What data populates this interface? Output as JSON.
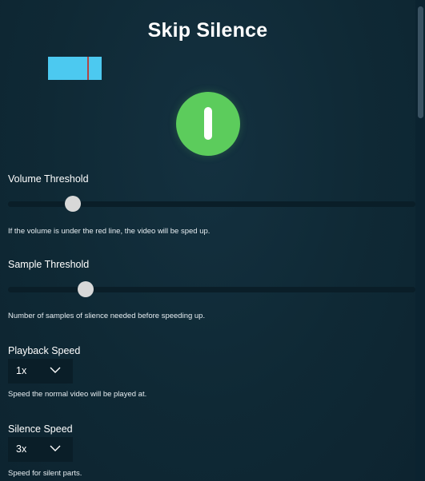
{
  "app": {
    "title": "Skip Silence"
  },
  "volume_meter": {
    "level": 1.0,
    "threshold": 0.73
  },
  "toggle": {
    "state": "on",
    "color": "#5ccc5c",
    "icon": "power-icon"
  },
  "settings": {
    "volume_threshold": {
      "label": "Volume Threshold",
      "value_fraction": 0.16,
      "help": "If the volume is under the red line, the video will be sped up."
    },
    "sample_threshold": {
      "label": "Sample Threshold",
      "value_fraction": 0.19,
      "help": "Number of samples of slience needed before speeding up."
    },
    "playback_speed": {
      "label": "Playback Speed",
      "selected": "1x",
      "help": "Speed the normal video will be played at."
    },
    "silence_speed": {
      "label": "Silence Speed",
      "selected": "3x",
      "help": "Speed for silent parts."
    }
  },
  "colors": {
    "background": "#0f2a37",
    "meter": "#4cc9f0",
    "threshold_line": "#b04545",
    "accent_green": "#5ccc5c"
  }
}
